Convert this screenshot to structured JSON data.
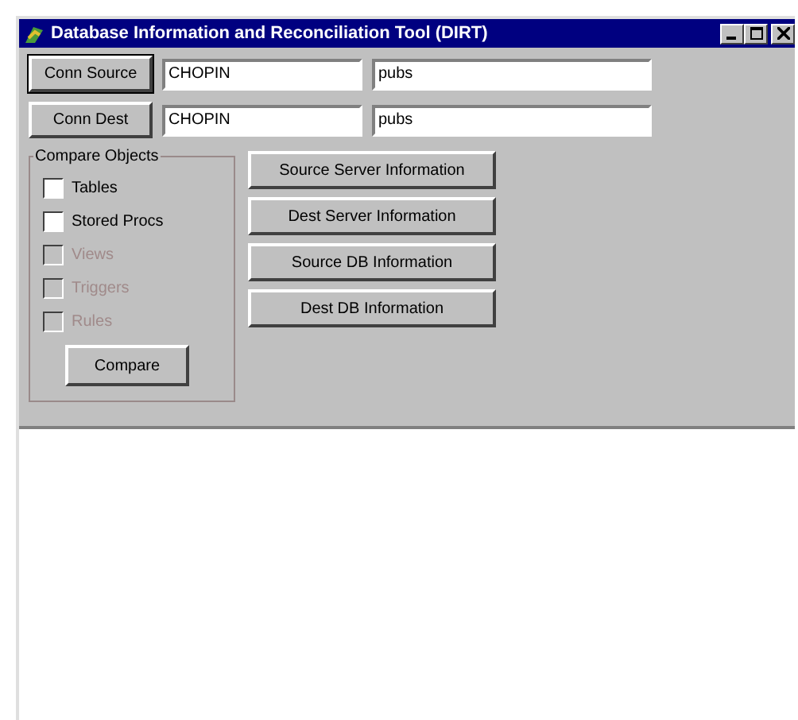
{
  "window": {
    "title": "Database Information and Reconciliation Tool (DIRT)"
  },
  "connections": [
    {
      "button": "Conn Source",
      "focused": true,
      "server": "CHOPIN",
      "database": "pubs"
    },
    {
      "button": "Conn Dest",
      "focused": false,
      "server": "CHOPIN",
      "database": "pubs"
    }
  ],
  "compare_objects": {
    "title": "Compare Objects",
    "options": [
      {
        "label": "Tables",
        "checked": false,
        "disabled": false
      },
      {
        "label": "Stored Procs",
        "checked": false,
        "disabled": false
      },
      {
        "label": "Views",
        "checked": false,
        "disabled": true
      },
      {
        "label": "Triggers",
        "checked": false,
        "disabled": true
      },
      {
        "label": "Rules",
        "checked": false,
        "disabled": true
      }
    ],
    "button": "Compare"
  },
  "info_buttons": [
    "Source Server Information",
    "Dest Server Information",
    "Source DB Information",
    "Dest DB Information"
  ]
}
